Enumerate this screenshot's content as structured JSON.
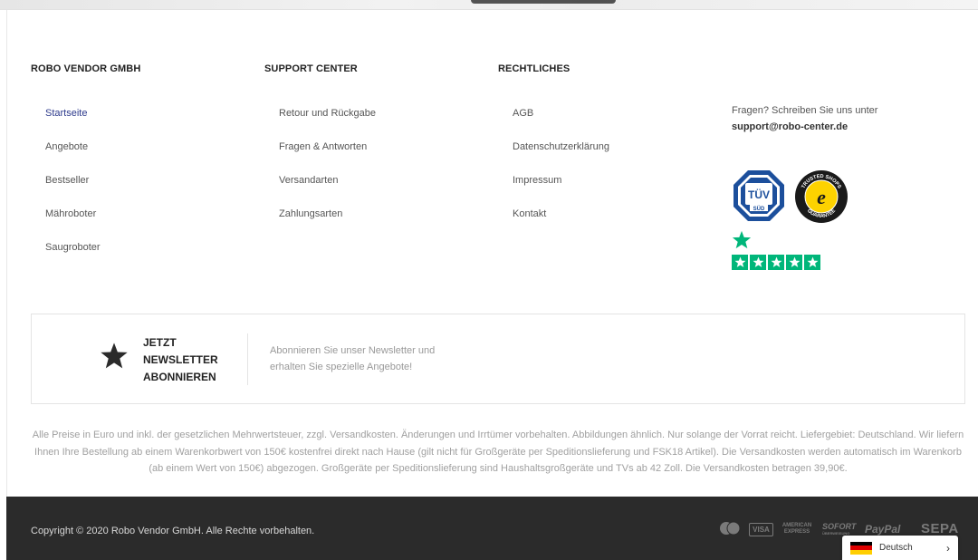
{
  "columns": [
    {
      "heading": "ROBO VENDOR GMBH",
      "links": [
        "Startseite",
        "Angebote",
        "Bestseller",
        "Mähroboter",
        "Saugroboter"
      ],
      "active_index": 0
    },
    {
      "heading": "SUPPORT CENTER",
      "links": [
        "Retour und Rückgabe",
        "Fragen & Antworten",
        "Versandarten",
        "Zahlungsarten"
      ]
    },
    {
      "heading": "RECHTLICHES",
      "links": [
        "AGB",
        "Datenschutzerklärung",
        "Impressum",
        "Kontakt"
      ]
    }
  ],
  "contact": {
    "text": "Fragen? Schreiben Sie uns unter",
    "email": "support@robo-center.de"
  },
  "badges": {
    "tuv": {
      "line1": "TÜV",
      "line2": "SÜD"
    },
    "trusted_shops": {
      "top": "TRUSTED SHOPS",
      "bottom": "GUARANTEE",
      "letter": "e"
    },
    "trustpilot_stars": 5
  },
  "newsletter": {
    "title_lines": [
      "JETZT",
      "NEWSLETTER",
      "ABONNIEREN"
    ],
    "text": "Abonnieren Sie unser Newsletter und erhalten Sie spezielle Angebote!"
  },
  "disclaimer": "Alle Preise in Euro und inkl. der gesetzlichen Mehrwertsteuer, zzgl. Versandkosten. Änderungen und Irrtümer vorbehalten. Abbildungen ähnlich. Nur solange der Vorrat reicht. Liefergebiet: Deutschland. Wir liefern Ihnen Ihre Bestellung ab einem Warenkorbwert von 150€ kostenfrei direkt nach Hause (gilt nicht für Großgeräte per Speditionslieferung und FSK18 Artikel). Die Versandkosten werden automatisch im Warenkorb (ab einem Wert von 150€) abgezogen. Großgeräte per Speditionslieferung sind Haushaltsgroßgeräte und TVs ab 42 Zoll. Die Versandkosten betragen 39,90€.",
  "footer": {
    "copyright": "Copyright © 2020 Robo Vendor GmbH. Alle Rechte vorbehalten.",
    "payments": {
      "visa": "VISA",
      "amex_line1": "AMERICAN",
      "amex_line2": "EXPRESS",
      "sofort": "SOFORT",
      "sofort_sub": "ÜBERWEISUNG",
      "paypal": "PayPal",
      "sepa": "SEPA"
    }
  },
  "language": {
    "label": "Deutsch",
    "flag_colors": [
      "#000000",
      "#dd0000",
      "#ffce00"
    ]
  },
  "colors": {
    "active_link": "#2d3a8c",
    "footer_bg": "#2b2b2b",
    "trustpilot_green": "#00b67a"
  }
}
